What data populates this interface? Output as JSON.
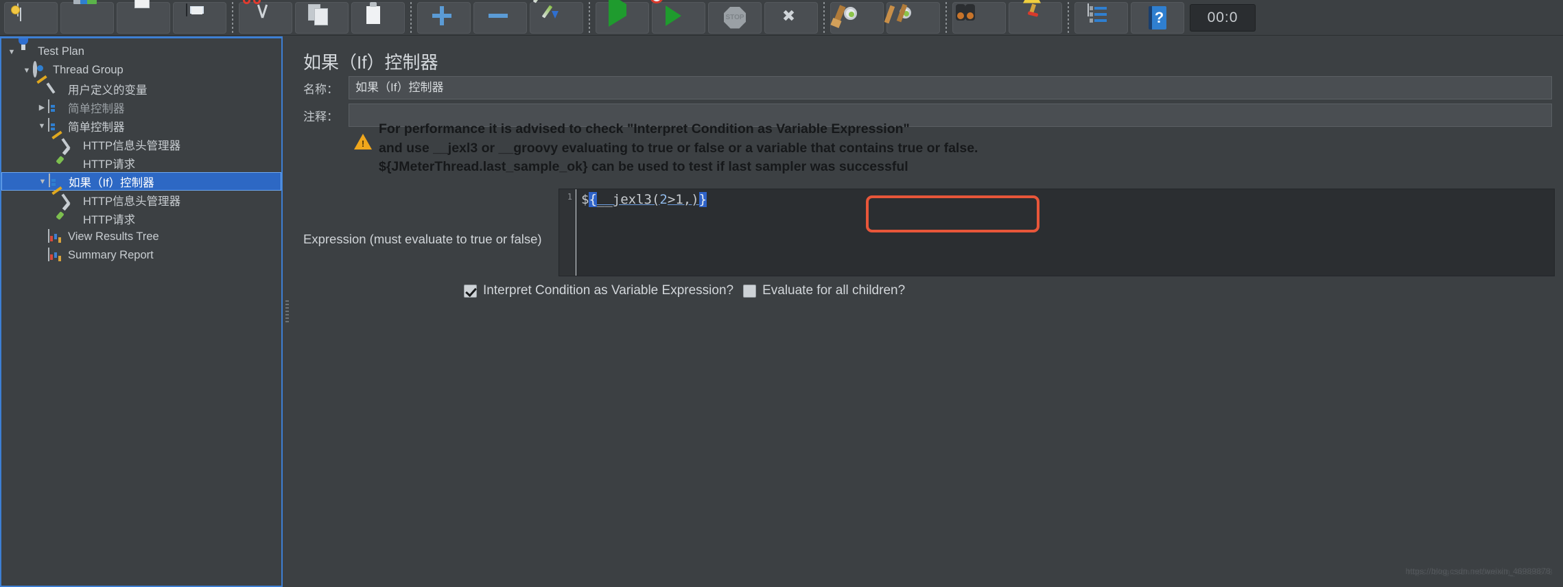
{
  "toolbar": {
    "buttons": [
      {
        "name": "new-test-plan",
        "icon": "new-file-icon",
        "label": "New"
      },
      {
        "name": "templates",
        "icon": "templates-icon",
        "label": "Templates"
      },
      {
        "name": "open",
        "icon": "open-folder-icon",
        "label": "Open"
      },
      {
        "name": "save",
        "icon": "save-floppy-icon",
        "label": "Save"
      },
      {
        "name": "cut",
        "icon": "scissors-icon",
        "label": "Cut"
      },
      {
        "name": "copy",
        "icon": "copy-icon",
        "label": "Copy"
      },
      {
        "name": "paste",
        "icon": "clipboard-paste-icon",
        "label": "Paste"
      },
      {
        "name": "expand-all",
        "icon": "plus-icon",
        "label": "Expand All"
      },
      {
        "name": "collapse-all",
        "icon": "minus-icon",
        "label": "Collapse All"
      },
      {
        "name": "toggle",
        "icon": "toggle-icon",
        "label": "Toggle"
      },
      {
        "name": "start",
        "icon": "play-green-icon",
        "label": "Start"
      },
      {
        "name": "start-no-pauses",
        "icon": "play-no-pauses-icon",
        "label": "Start no pauses"
      },
      {
        "name": "stop",
        "icon": "stop-octagon-icon",
        "label": "Stop"
      },
      {
        "name": "shutdown",
        "icon": "shutdown-x-icon",
        "label": "Shutdown"
      },
      {
        "name": "clear",
        "icon": "gear-broom-icon",
        "label": "Clear"
      },
      {
        "name": "clear-all",
        "icon": "gear-broom-double-icon",
        "label": "Clear All"
      },
      {
        "name": "search",
        "icon": "binoculars-icon",
        "label": "Search"
      },
      {
        "name": "reset-search",
        "icon": "yellow-broom-icon",
        "label": "Reset Search"
      },
      {
        "name": "function-helper",
        "icon": "log-list-icon",
        "label": "Function Helper"
      },
      {
        "name": "help",
        "icon": "help-book-icon",
        "label": "Help"
      }
    ],
    "clock": "00:0"
  },
  "tree": {
    "nodes": [
      {
        "label": "Test Plan",
        "icon": "flask-icon",
        "depth": 0,
        "twist": "▼",
        "state": "normal"
      },
      {
        "label": "Thread Group",
        "icon": "gear-icon",
        "depth": 1,
        "twist": "▼",
        "state": "normal"
      },
      {
        "label": "用户定义的变量",
        "icon": "wrench-icon",
        "depth": 2,
        "twist": "",
        "state": "normal"
      },
      {
        "label": "简单控制器",
        "icon": "controller-icon",
        "depth": 2,
        "twist": "▶",
        "state": "disabled"
      },
      {
        "label": "简单控制器",
        "icon": "controller-icon",
        "depth": 2,
        "twist": "▼",
        "state": "normal"
      },
      {
        "label": "HTTP信息头管理器",
        "icon": "wrench-icon",
        "depth": 3,
        "twist": "",
        "state": "normal"
      },
      {
        "label": "HTTP请求",
        "icon": "pen-icon",
        "depth": 3,
        "twist": "",
        "state": "normal"
      },
      {
        "label": "如果（If）控制器",
        "icon": "controller-icon",
        "depth": 2,
        "twist": "▼",
        "state": "selected"
      },
      {
        "label": "HTTP信息头管理器",
        "icon": "wrench-icon",
        "depth": 3,
        "twist": "",
        "state": "normal"
      },
      {
        "label": "HTTP请求",
        "icon": "pen-icon",
        "depth": 3,
        "twist": "",
        "state": "normal"
      },
      {
        "label": "View Results Tree",
        "icon": "chart-icon",
        "depth": 2,
        "twist": "",
        "state": "normal"
      },
      {
        "label": "Summary Report",
        "icon": "chart-icon",
        "depth": 2,
        "twist": "",
        "state": "normal"
      }
    ]
  },
  "panel": {
    "title": "如果（If）控制器",
    "name_label": "名称：",
    "name_value": "如果（If）控制器",
    "comment_label": "注释：",
    "comment_value": "",
    "warning_lines": [
      "For performance it is advised to check \"Interpret Condition as Variable Expression\"",
      "and use __jexl3 or __groovy evaluating to true or false or a variable that contains true or false.",
      "${JMeterThread.last_sample_ok} can be used to test if last sampler was successful"
    ],
    "expression_label": "Expression (must evaluate to true or false)",
    "expression_gutter": "1",
    "expression_prefix": "$",
    "expression_brace_open": "{",
    "expression_body_a": "__jexl3(",
    "expression_num": "2",
    "expression_body_b": ">1,)",
    "expression_brace_close": "}",
    "checkbox_interpret_label": "Interpret Condition as Variable Expression?",
    "checkbox_interpret_checked": true,
    "checkbox_evaluate_label": "Evaluate for all children?",
    "checkbox_evaluate_checked": false,
    "accent_selection_color": "#2d68c4",
    "annotation_box_color": "#e8563a"
  },
  "watermark": {
    "line_a": "https://blog.csdn.net/weixin_46989878",
    "line_b": "https://blog.csdn.net/weixin_46989878"
  }
}
